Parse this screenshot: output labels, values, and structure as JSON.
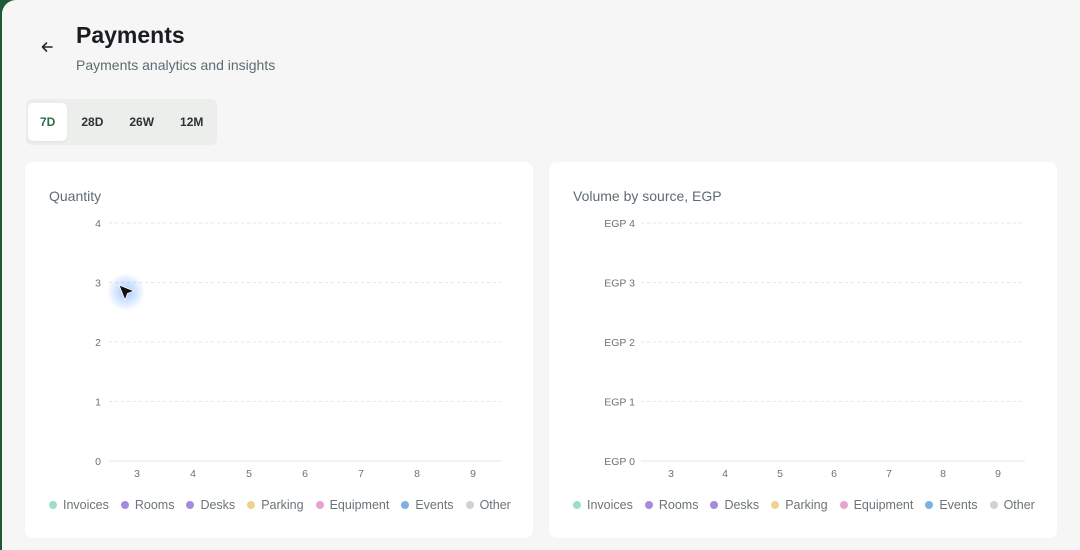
{
  "header": {
    "title": "Payments",
    "subtitle": "Payments analytics and insights"
  },
  "range_tabs": [
    {
      "label": "7D",
      "active": true
    },
    {
      "label": "28D",
      "active": false
    },
    {
      "label": "26W",
      "active": false
    },
    {
      "label": "12M",
      "active": false
    }
  ],
  "colors": {
    "accent": "#2f6d4a",
    "legend": [
      "#9fdcc9",
      "#a58be0",
      "#a58be0",
      "#ecd48a",
      "#e8a2cf",
      "#7fb0e2",
      "#cfd2d4"
    ]
  },
  "legend": [
    "Invoices",
    "Rooms",
    "Desks",
    "Parking",
    "Equipment",
    "Events",
    "Other"
  ],
  "chart_data": [
    {
      "type": "bar",
      "title": "Quantity",
      "categories": [
        "3",
        "4",
        "5",
        "6",
        "7",
        "8",
        "9"
      ],
      "series": [
        {
          "name": "Invoices",
          "values": [
            0,
            0,
            0,
            0,
            0,
            0,
            0
          ]
        },
        {
          "name": "Rooms",
          "values": [
            0,
            0,
            0,
            0,
            0,
            0,
            0
          ]
        },
        {
          "name": "Desks",
          "values": [
            0,
            0,
            0,
            0,
            0,
            0,
            0
          ]
        },
        {
          "name": "Parking",
          "values": [
            0,
            0,
            0,
            0,
            0,
            0,
            0
          ]
        },
        {
          "name": "Equipment",
          "values": [
            0,
            0,
            0,
            0,
            0,
            0,
            0
          ]
        },
        {
          "name": "Events",
          "values": [
            0,
            0,
            0,
            0,
            0,
            0,
            0
          ]
        },
        {
          "name": "Other",
          "values": [
            0,
            0,
            0,
            0,
            0,
            0,
            0
          ]
        }
      ],
      "ylim": [
        0,
        4
      ],
      "yticks": [
        "0",
        "1",
        "2",
        "3",
        "4"
      ],
      "grid": true,
      "legend_position": "bottom"
    },
    {
      "type": "bar",
      "title": "Volume by source, EGP",
      "categories": [
        "3",
        "4",
        "5",
        "6",
        "7",
        "8",
        "9"
      ],
      "series": [
        {
          "name": "Invoices",
          "values": [
            0,
            0,
            0,
            0,
            0,
            0,
            0
          ]
        },
        {
          "name": "Rooms",
          "values": [
            0,
            0,
            0,
            0,
            0,
            0,
            0
          ]
        },
        {
          "name": "Desks",
          "values": [
            0,
            0,
            0,
            0,
            0,
            0,
            0
          ]
        },
        {
          "name": "Parking",
          "values": [
            0,
            0,
            0,
            0,
            0,
            0,
            0
          ]
        },
        {
          "name": "Equipment",
          "values": [
            0,
            0,
            0,
            0,
            0,
            0,
            0
          ]
        },
        {
          "name": "Events",
          "values": [
            0,
            0,
            0,
            0,
            0,
            0,
            0
          ]
        },
        {
          "name": "Other",
          "values": [
            0,
            0,
            0,
            0,
            0,
            0,
            0
          ]
        }
      ],
      "ylim": [
        0,
        4
      ],
      "yticks": [
        "EGP 0",
        "EGP 1",
        "EGP 2",
        "EGP 3",
        "EGP 4"
      ],
      "grid": true,
      "legend_position": "bottom"
    }
  ]
}
